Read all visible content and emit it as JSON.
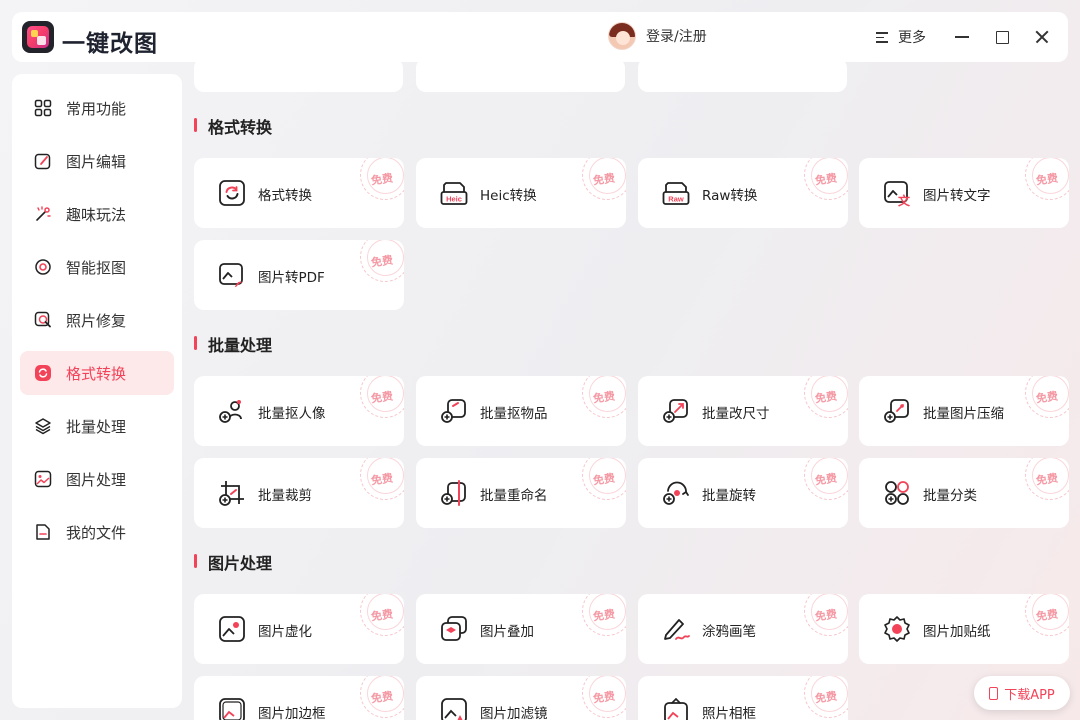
{
  "app": {
    "title": "一键改图"
  },
  "header": {
    "login": "登录/注册",
    "more": "更多"
  },
  "sidebar": {
    "items": [
      {
        "label": "常用功能",
        "icon": "grid-icon"
      },
      {
        "label": "图片编辑",
        "icon": "edit-icon"
      },
      {
        "label": "趣味玩法",
        "icon": "magic-wand-icon"
      },
      {
        "label": "智能抠图",
        "icon": "target-icon"
      },
      {
        "label": "照片修复",
        "icon": "repair-icon"
      },
      {
        "label": "格式转换",
        "icon": "convert-icon",
        "active": true
      },
      {
        "label": "批量处理",
        "icon": "layers-icon"
      },
      {
        "label": "图片处理",
        "icon": "image-icon"
      },
      {
        "label": "我的文件",
        "icon": "file-icon"
      }
    ]
  },
  "badge": "免费",
  "sections": [
    {
      "title": "格式转换",
      "cards": [
        {
          "label": "格式转换",
          "icon": "format-convert-icon"
        },
        {
          "label": "Heic转换",
          "icon": "heic-icon",
          "tag": "Heic"
        },
        {
          "label": "Raw转换",
          "icon": "raw-icon",
          "tag": "Raw"
        },
        {
          "label": "图片转文字",
          "icon": "image-to-text-icon"
        },
        {
          "label": "图片转PDF",
          "icon": "image-to-pdf-icon"
        }
      ]
    },
    {
      "title": "批量处理",
      "cards": [
        {
          "label": "批量抠人像",
          "icon": "batch-portrait-icon"
        },
        {
          "label": "批量抠物品",
          "icon": "batch-object-icon"
        },
        {
          "label": "批量改尺寸",
          "icon": "batch-resize-icon"
        },
        {
          "label": "批量图片压缩",
          "icon": "batch-compress-icon"
        },
        {
          "label": "批量裁剪",
          "icon": "batch-crop-icon"
        },
        {
          "label": "批量重命名",
          "icon": "batch-rename-icon"
        },
        {
          "label": "批量旋转",
          "icon": "batch-rotate-icon"
        },
        {
          "label": "批量分类",
          "icon": "batch-classify-icon"
        }
      ]
    },
    {
      "title": "图片处理",
      "cards": [
        {
          "label": "图片虚化",
          "icon": "blur-icon"
        },
        {
          "label": "图片叠加",
          "icon": "overlay-icon"
        },
        {
          "label": "涂鸦画笔",
          "icon": "brush-icon"
        },
        {
          "label": "图片加贴纸",
          "icon": "sticker-icon"
        },
        {
          "label": "图片加边框",
          "icon": "border-icon"
        },
        {
          "label": "图片加滤镜",
          "icon": "filter-icon"
        },
        {
          "label": "照片相框",
          "icon": "photo-frame-icon"
        }
      ]
    }
  ],
  "download": {
    "label": "下载APP"
  },
  "colors": {
    "accent": "#f24358",
    "accent_light": "#fde8ea",
    "badge": "#f59aa5"
  }
}
